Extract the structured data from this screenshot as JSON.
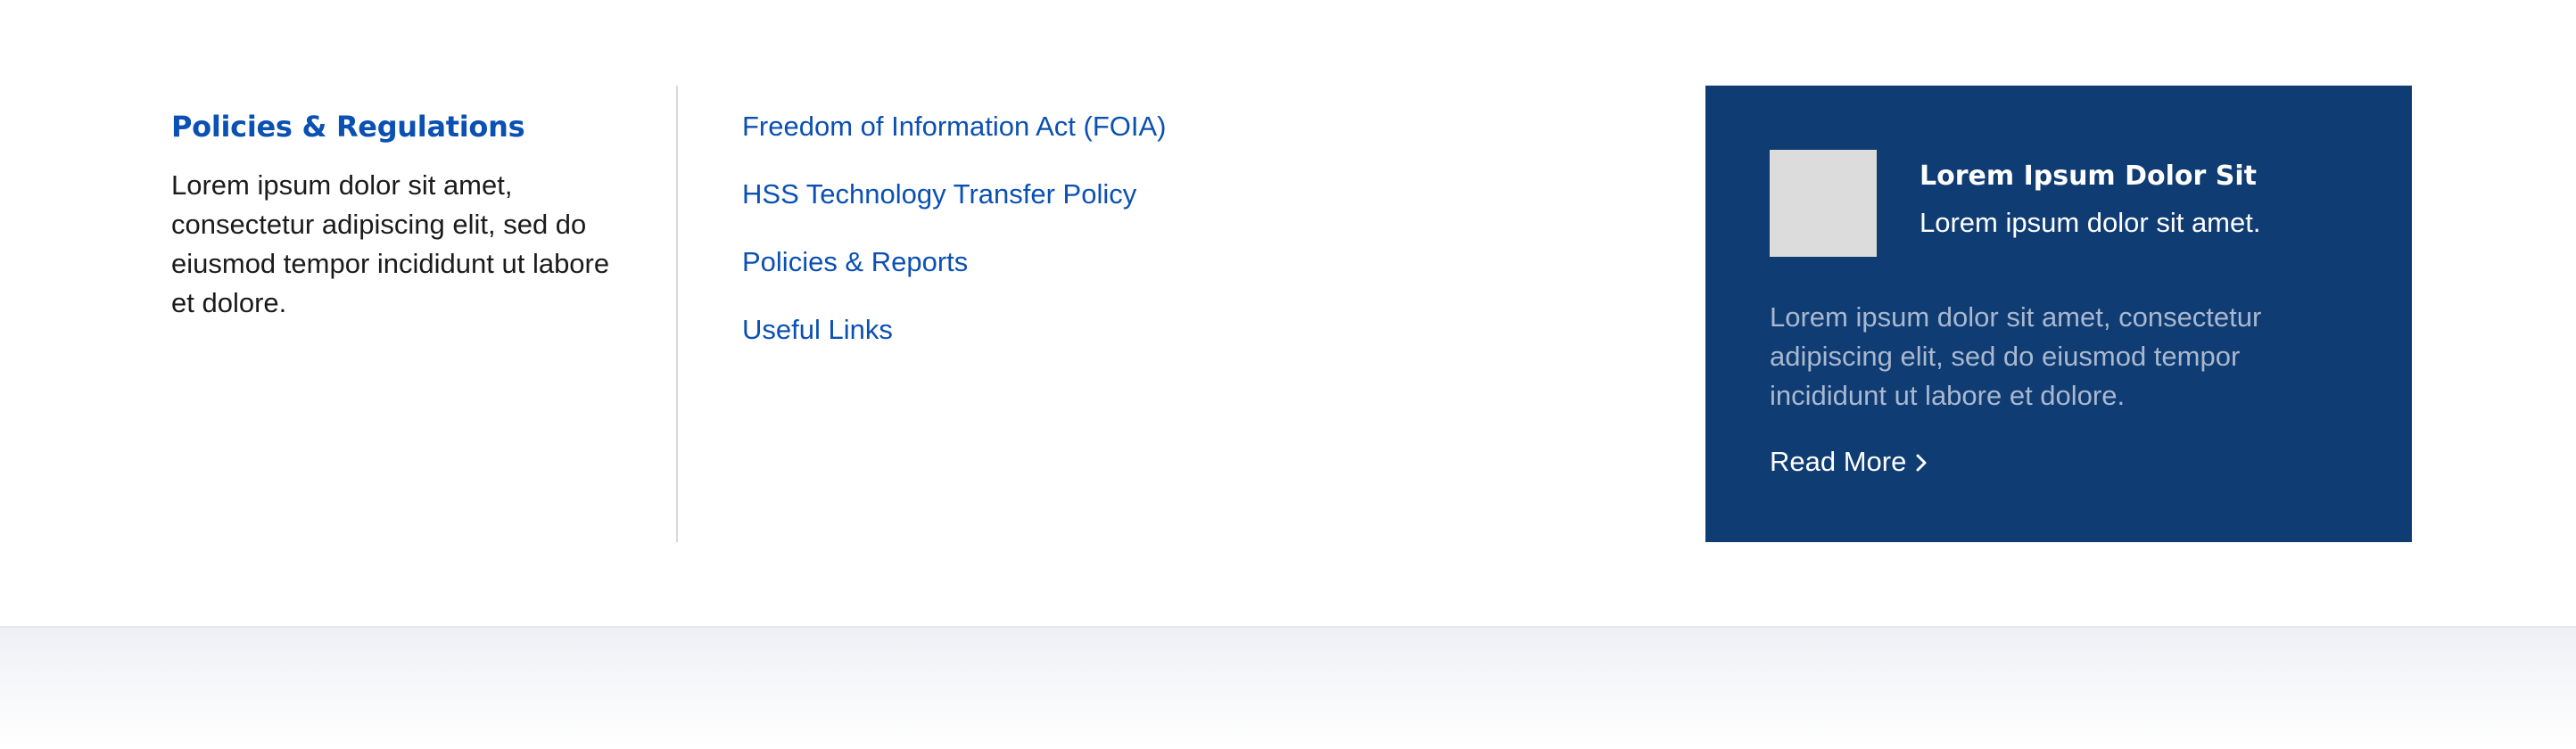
{
  "intro": {
    "title": "Policies & Regulations",
    "text": "Lorem ipsum dolor sit amet, consectetur adipiscing elit, sed do eiusmod tempor incididunt ut labore et dolore."
  },
  "links": [
    {
      "label": "Freedom of Information Act (FOIA)"
    },
    {
      "label": "HSS Technology Transfer Policy"
    },
    {
      "label": "Policies & Reports"
    },
    {
      "label": "Useful Links"
    }
  ],
  "promo": {
    "title": "Lorem Ipsum Dolor Sit",
    "subtitle": "Lorem ipsum dolor sit amet.",
    "text": "Lorem ipsum dolor sit amet, consectetur adipiscing elit, sed do eiusmod tempor incididunt ut labore et dolore.",
    "read_more_label": "Read More",
    "read_more_icon": "chevron-right-icon"
  },
  "colors": {
    "link": "#0b50b3",
    "promo_background": "#0f3c73",
    "promo_text_muted": "#a9b8cf",
    "thumbnail_placeholder": "#dcdcdc",
    "divider": "#d9d9d9"
  }
}
